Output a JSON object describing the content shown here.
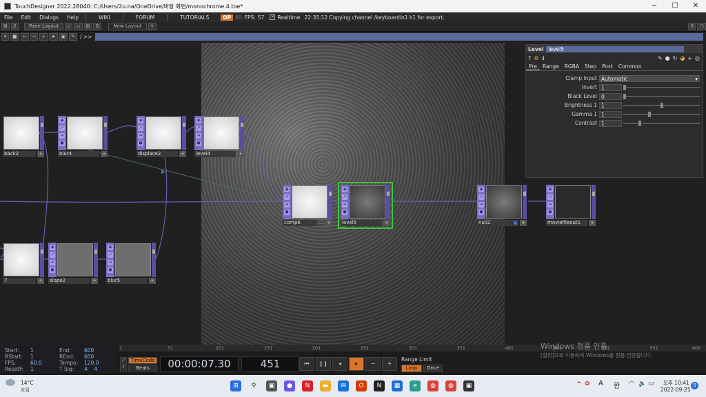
{
  "window": {
    "title": "TouchDesigner 2022.28040: C:/Users/2u.na/OneDrive/바탕 화면/monochrome.4.toe*"
  },
  "menu": {
    "items": [
      "File",
      "Edit",
      "Dialogs",
      "Help"
    ],
    "links": [
      "WIKI",
      "FORUM",
      "TUTORIALS"
    ],
    "badge": "OP",
    "frame": "60",
    "fps_label": "FPS:",
    "fps": "57",
    "realtime_label": "Realtime",
    "status": "22:35:12 Copying channel /keyboardin1 k1 for export."
  },
  "panebar": {
    "pane_layout": "Pane Layout",
    "new_layout": "New Layout",
    "right_value": "0"
  },
  "pathbar": {
    "path": "/ >>"
  },
  "nodes": [
    {
      "label": "back2",
      "thumb": "white"
    },
    {
      "label": "blur4",
      "thumb": "white"
    },
    {
      "label": "displace2",
      "thumb": "white"
    },
    {
      "label": "level4",
      "thumb": "white"
    },
    {
      "label": "comp6",
      "thumb": "white"
    },
    {
      "label": "level5",
      "thumb": "dark"
    },
    {
      "label": "null2",
      "thumb": "dark"
    },
    {
      "label": "moviefileout1",
      "thumb": "black"
    },
    {
      "label": "7",
      "thumb": "white"
    },
    {
      "label": "slope2",
      "thumb": "gray"
    },
    {
      "label": "blur5",
      "thumb": "gray"
    }
  ],
  "params": {
    "op_type": "Level",
    "op_name": "level5",
    "tabs": [
      "Pre",
      "Range",
      "RGBA",
      "Step",
      "Post",
      "Common"
    ],
    "active_tab": "Pre",
    "rows": [
      {
        "label": "Clamp Input",
        "value": "Automatic",
        "kind": "menu"
      },
      {
        "label": "Invert",
        "value": "1",
        "kind": "slider",
        "level": 0
      },
      {
        "label": "Black Level",
        "value": "0",
        "kind": "slider",
        "level": 0
      },
      {
        "label": "Brightness 1",
        "value": "1",
        "kind": "slider",
        "level": 0.5
      },
      {
        "label": "Gamma 1",
        "value": "1",
        "kind": "slider",
        "level": 0.33
      },
      {
        "label": "Contrast",
        "value": "1",
        "kind": "slider",
        "level": 0.2
      }
    ]
  },
  "timeline": {
    "info": [
      {
        "k": "Start:",
        "v": "1"
      },
      {
        "k": "End:",
        "v": "600"
      },
      {
        "k": "RStart:",
        "v": "1"
      },
      {
        "k": "REnd:",
        "v": "600"
      },
      {
        "k": "FPS:",
        "v": "60.0"
      },
      {
        "k": "Tempo:",
        "v": "120.0"
      },
      {
        "k": "ResetF:",
        "v": "1"
      },
      {
        "k": "T Sig:",
        "v": "4    4"
      }
    ],
    "ruler_ticks": [
      "1",
      "51",
      "101",
      "151",
      "201",
      "251",
      "301",
      "351",
      "401",
      "451",
      "501",
      "551",
      "600"
    ],
    "timecode_label": "TimeCode",
    "beats_label": "Beats",
    "timecode": "00:00:07.30",
    "frame": "451",
    "range_limit_label": "Range Limit",
    "loop": "Loop",
    "once": "Once"
  },
  "watermark": {
    "line1": "Windows 정품 인증",
    "line2": "[설정]으로 이동하여 Windows를 정품 인증합니다."
  },
  "taskbar": {
    "weather_temp": "14°C",
    "weather_desc": "흐림",
    "time_ampm": "오후 10:41",
    "date": "2022-09-25",
    "lang": "A",
    "ime": "한",
    "notif": "5"
  }
}
